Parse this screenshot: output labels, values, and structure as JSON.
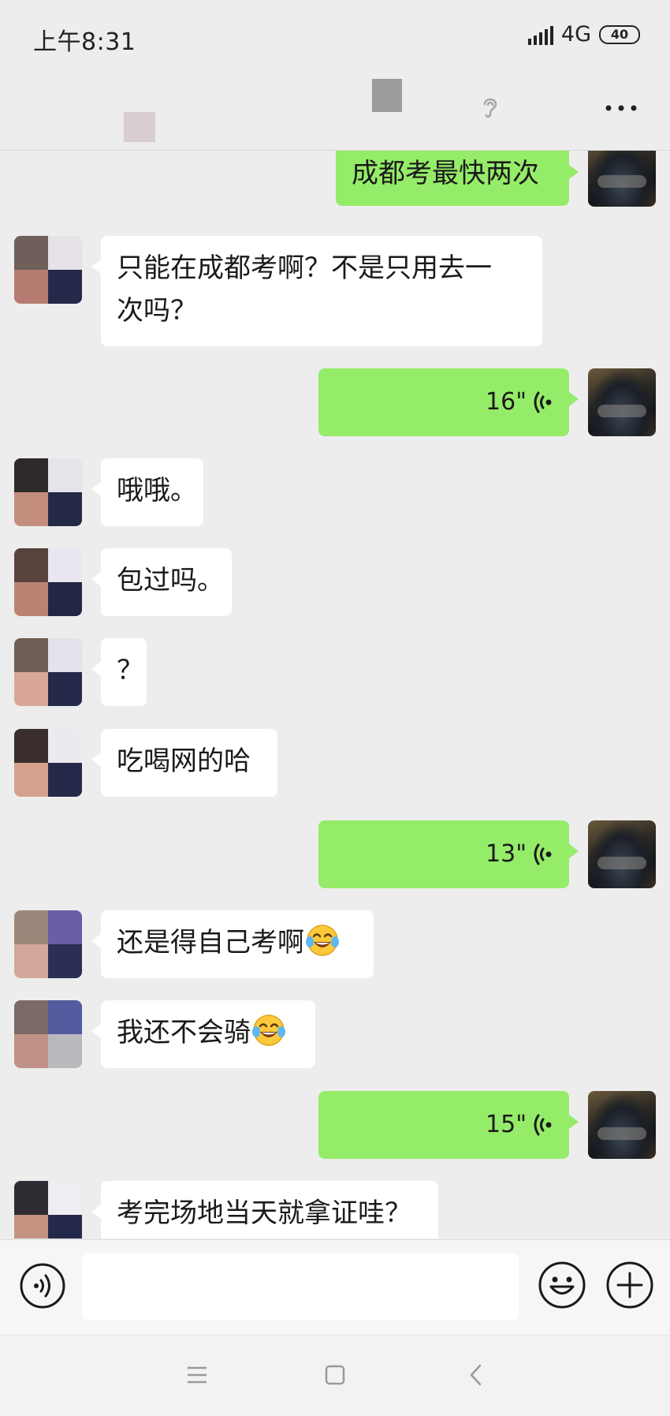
{
  "status_bar": {
    "time": "上午8:31",
    "network": "4G",
    "battery": "40"
  },
  "messages": [
    {
      "side": "sent",
      "type": "text",
      "text": "成都考最快两次"
    },
    {
      "side": "received",
      "type": "text",
      "lines": [
        "只能在成都考啊？不是只用去一",
        "次吗？"
      ]
    },
    {
      "side": "sent",
      "type": "voice",
      "duration": "16\""
    },
    {
      "side": "received",
      "type": "text",
      "text": "哦哦。"
    },
    {
      "side": "received",
      "type": "text",
      "text": "包过吗。"
    },
    {
      "side": "received",
      "type": "text",
      "text": "？"
    },
    {
      "side": "received",
      "type": "text",
      "text": "吃喝网的哈"
    },
    {
      "side": "sent",
      "type": "voice",
      "duration": "13\""
    },
    {
      "side": "received",
      "type": "text",
      "text": "还是得自己考啊",
      "emoji": "tears-of-joy"
    },
    {
      "side": "received",
      "type": "text",
      "text": "我还不会骑",
      "emoji": "tears-of-joy"
    },
    {
      "side": "sent",
      "type": "voice",
      "duration": "15\""
    },
    {
      "side": "received",
      "type": "text",
      "text": "考完场地当天就拿证哇？"
    }
  ],
  "input_bar": {
    "placeholder": ""
  },
  "icons": {
    "status": [
      "signal-icon",
      "battery-icon"
    ],
    "header": [
      "earpiece-mode-icon",
      "more-icon"
    ],
    "input": [
      "voice-input-icon",
      "emoji-icon",
      "plus-icon"
    ],
    "system_nav": [
      "menu-icon",
      "home-icon",
      "back-icon"
    ]
  },
  "colors": {
    "sent_bubble": "#95ec69",
    "received_bubble": "#ffffff",
    "background": "#ededed"
  }
}
